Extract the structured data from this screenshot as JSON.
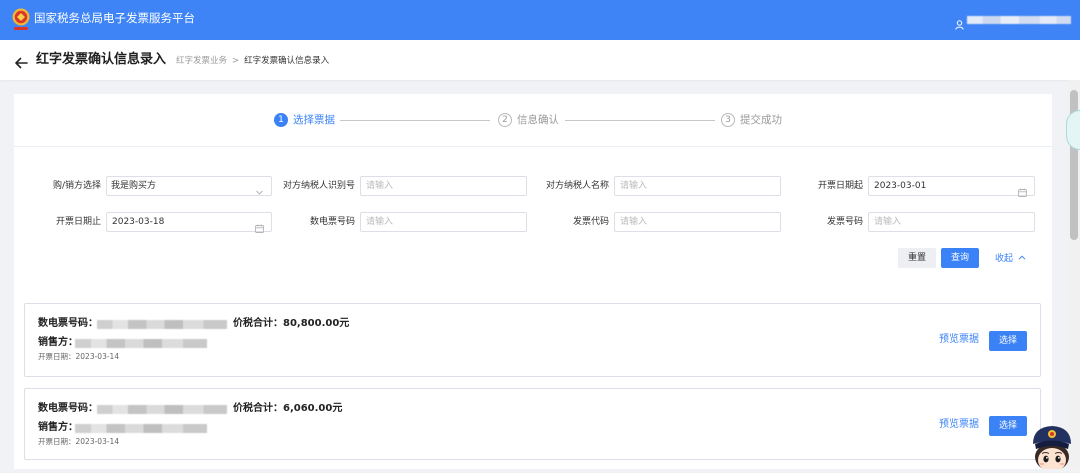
{
  "header": {
    "title": "国家税务总局电子发票服务平台",
    "logo_icon": "tax-emblem-icon",
    "user_icon": "user-icon"
  },
  "breadcrumb": {
    "back_icon": "back-arrow-icon",
    "page_title": "红字发票确认信息录入",
    "parent": "红字发票业务",
    "separator": ">",
    "current": "红字发票确认信息录入"
  },
  "steps": [
    {
      "number": "1",
      "label": "选择票据",
      "active": true
    },
    {
      "number": "2",
      "label": "信息确认",
      "active": false
    },
    {
      "number": "3",
      "label": "提交成功",
      "active": false
    }
  ],
  "filters": {
    "fields": [
      {
        "label": "购/销方选择",
        "value": "我是购买方",
        "icon": "chevron-down-icon"
      },
      {
        "label": "对方纳税人识别号",
        "placeholder": "请输入"
      },
      {
        "label": "对方纳税人名称",
        "placeholder": "请输入"
      },
      {
        "label": "开票日期起",
        "value": "2023-03-01",
        "icon": "calendar-icon"
      },
      {
        "label": "开票日期止",
        "value": "2023-03-18",
        "icon": "calendar-icon"
      },
      {
        "label": "数电票号码",
        "placeholder": "请输入"
      },
      {
        "label": "发票代码",
        "placeholder": "请输入"
      },
      {
        "label": "发票号码",
        "placeholder": "请输入"
      }
    ],
    "reset_label": "重置",
    "query_label": "查询",
    "collapse_label": "收起",
    "collapse_icon": "chevron-up-icon"
  },
  "invoices": [
    {
      "number_label": "数电票号码：",
      "total_label": "价税合计：",
      "total": "80,800.00元",
      "seller_label": "销售方：",
      "date_label": "开票日期：",
      "date": "2023-03-14",
      "preview_label": "预览票据",
      "select_label": "选择"
    },
    {
      "number_label": "数电票号码：",
      "total_label": "价税合计：",
      "total": "6,060.00元",
      "seller_label": "销售方：",
      "date_label": "开票日期：",
      "date": "2023-03-14",
      "preview_label": "预览票据",
      "select_label": "选择"
    }
  ],
  "colors": {
    "header": "#3e84f6",
    "primary": "#3a82f6",
    "page_background": "#f0f2f5",
    "muted_text": "#999999"
  }
}
